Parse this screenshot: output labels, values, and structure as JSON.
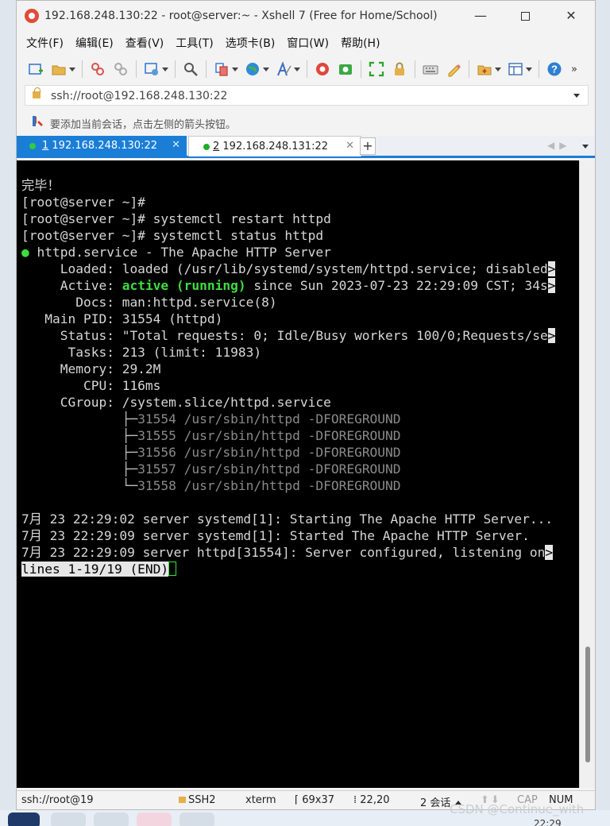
{
  "window": {
    "title": "192.168.248.130:22 - root@server:~ - Xshell 7 (Free for Home/School)",
    "minimize": "—",
    "close": "✕"
  },
  "menu": [
    "文件(F)",
    "编辑(E)",
    "查看(V)",
    "工具(T)",
    "选项卡(B)",
    "窗口(W)",
    "帮助(H)"
  ],
  "toolbar": {
    "overflow": "»",
    "icons": [
      "new-session-icon",
      "open-folder-icon",
      "connect-icon",
      "disconnect-icon",
      "properties-icon",
      "find-icon",
      "copy-icon",
      "globe-icon",
      "font-icon",
      "xshell-icon",
      "xftp-icon",
      "fullscreen-icon",
      "lock-icon",
      "keyboard-icon",
      "highlight-icon",
      "compose-icon",
      "layout-icon",
      "help-icon"
    ]
  },
  "address": {
    "value": "ssh://root@192.168.248.130:22"
  },
  "hint": {
    "text": "要添加当前会话，点击左侧的箭头按钮。"
  },
  "tabs": [
    {
      "number": "1",
      "label": " 192.168.248.130:22",
      "active": true,
      "close": "✕"
    },
    {
      "number": "2",
      "label": " 192.168.248.131:22",
      "active": false,
      "close": "✕"
    }
  ],
  "tab_add": "+",
  "tab_nav": "◀▶",
  "terminal": {
    "lines": [
      {
        "t": "完毕！"
      },
      {
        "t": "[root@server ~]#"
      },
      {
        "t": "[root@server ~]# systemctl restart httpd"
      },
      {
        "t": "[root@server ~]# systemctl status httpd"
      },
      {
        "dot": "●",
        "t": " httpd.service - The Apache HTTP Server"
      },
      {
        "t": "     Loaded: loaded (/usr/lib/systemd/system/httpd.service; disabled",
        "trunc": ">"
      },
      {
        "pre": "     Active: ",
        "green": "active (running)",
        "t": " since Sun 2023-07-23 22:29:09 CST; 34s",
        "trunc": ">"
      },
      {
        "t": "       Docs: man:httpd.service(8)"
      },
      {
        "t": "   Main PID: 31554 (httpd)"
      },
      {
        "t": "     Status: \"Total requests: 0; Idle/Busy workers 100/0;Requests/se",
        "trunc": ">"
      },
      {
        "t": "      Tasks: 213 (limit: 11983)"
      },
      {
        "t": "     Memory: 29.2M"
      },
      {
        "t": "        CPU: 116ms"
      },
      {
        "t": "     CGroup: /system.slice/httpd.service"
      },
      {
        "tree": "             ├─",
        "grey": "31554 /usr/sbin/httpd -DFOREGROUND"
      },
      {
        "tree": "             ├─",
        "grey": "31555 /usr/sbin/httpd -DFOREGROUND"
      },
      {
        "tree": "             ├─",
        "grey": "31556 /usr/sbin/httpd -DFOREGROUND"
      },
      {
        "tree": "             ├─",
        "grey": "31557 /usr/sbin/httpd -DFOREGROUND"
      },
      {
        "tree": "             └─",
        "grey": "31558 /usr/sbin/httpd -DFOREGROUND"
      },
      {
        "t": ""
      },
      {
        "t": "7月 23 22:29:02 server systemd[1]: Starting The Apache HTTP Server..."
      },
      {
        "t": "7月 23 22:29:09 server systemd[1]: Started The Apache HTTP Server."
      },
      {
        "t": "7月 23 22:29:09 server httpd[31554]: Server configured, listening on",
        "trunc": ">"
      },
      {
        "inv": "lines 1-19/19 (END)",
        "cursor": true
      }
    ]
  },
  "status": {
    "session": "ssh://root@19",
    "protocol": "SSH2",
    "term": "xterm",
    "size_icon": "⌈",
    "size": " 69x37",
    "pos_icon": "⁞",
    "pos": " 22,20",
    "sessions": "2 会话",
    "arrows": "⬆⬇",
    "caps": "CAP",
    "num": "NUM"
  },
  "watermark": "CSDN @Continue_with",
  "clock": "22:29",
  "colors": {
    "accent": "#1a7ed6",
    "terminal_bg": "#000000",
    "running_green": "#3fdc3f"
  }
}
